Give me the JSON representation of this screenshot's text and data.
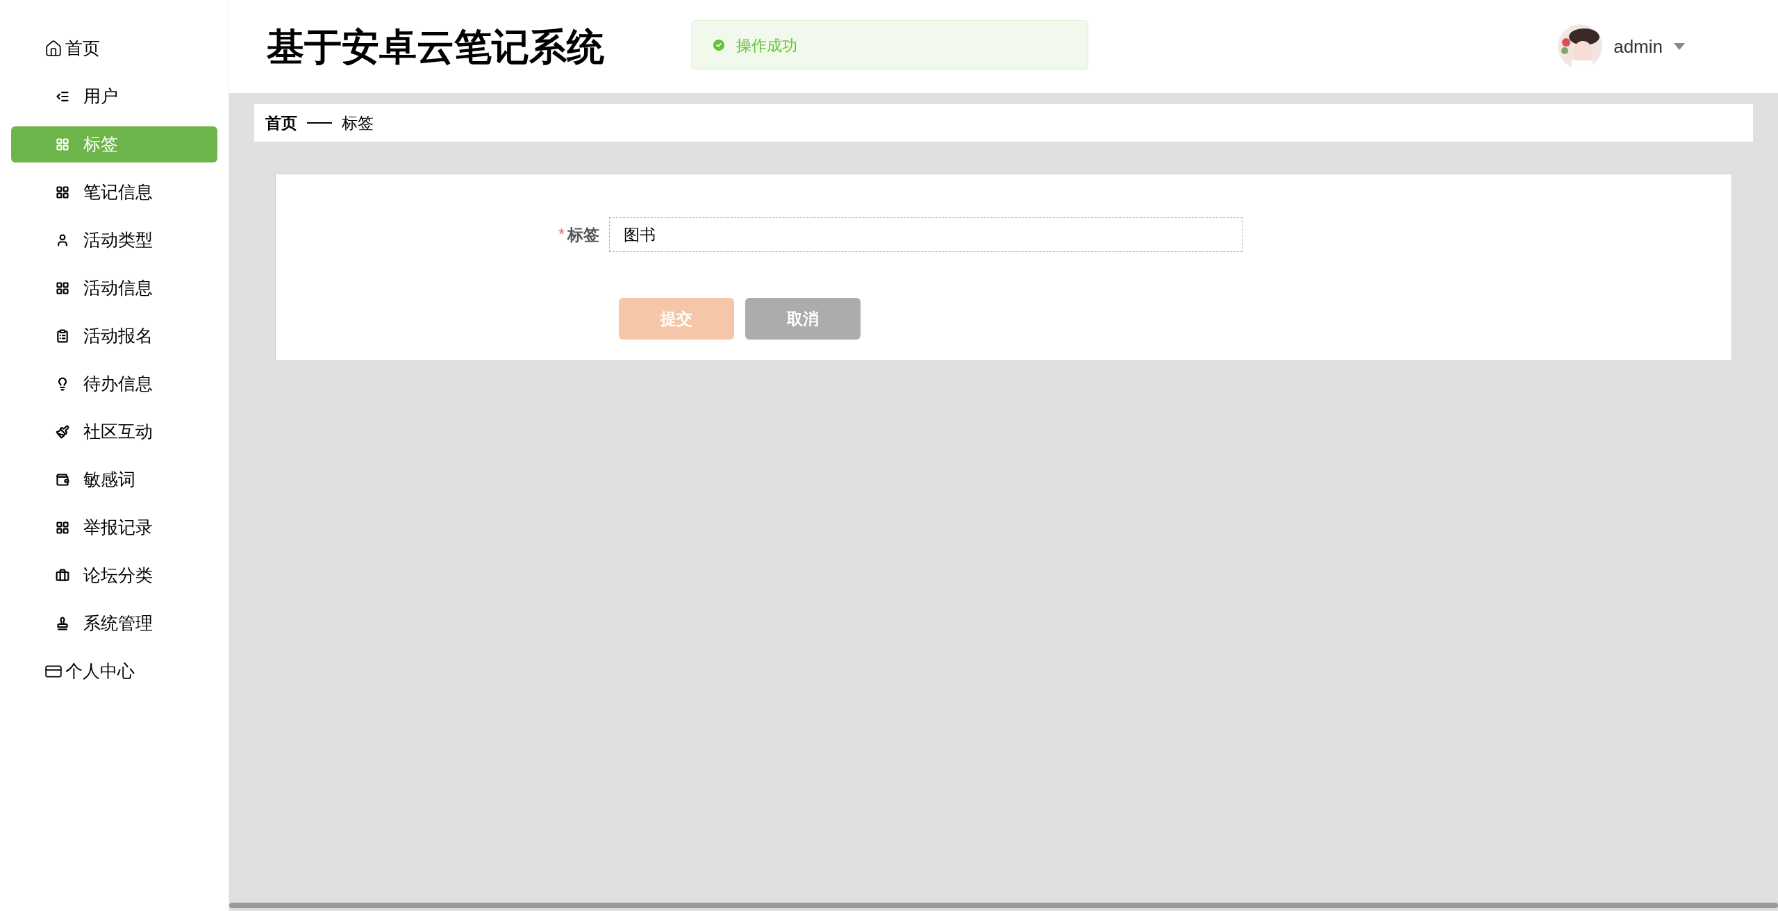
{
  "sidebar": {
    "items": [
      {
        "label": "首页",
        "kind": "top",
        "selected": false
      },
      {
        "label": "用户",
        "kind": "sub",
        "selected": false
      },
      {
        "label": "标签",
        "kind": "sub",
        "selected": true
      },
      {
        "label": "笔记信息",
        "kind": "sub",
        "selected": false
      },
      {
        "label": "活动类型",
        "kind": "sub",
        "selected": false
      },
      {
        "label": "活动信息",
        "kind": "sub",
        "selected": false
      },
      {
        "label": "活动报名",
        "kind": "sub",
        "selected": false
      },
      {
        "label": "待办信息",
        "kind": "sub",
        "selected": false
      },
      {
        "label": "社区互动",
        "kind": "sub",
        "selected": false
      },
      {
        "label": "敏感词",
        "kind": "sub",
        "selected": false
      },
      {
        "label": "举报记录",
        "kind": "sub",
        "selected": false
      },
      {
        "label": "论坛分类",
        "kind": "sub",
        "selected": false
      },
      {
        "label": "系统管理",
        "kind": "sub",
        "selected": false
      },
      {
        "label": "个人中心",
        "kind": "top",
        "selected": false
      }
    ]
  },
  "header": {
    "title": "基于安卓云笔记系统",
    "toast": "操作成功",
    "user": "admin"
  },
  "breadcrumb": [
    "首页",
    "标签"
  ],
  "form": {
    "fields": [
      {
        "label": "标签",
        "marker": "*",
        "value": "图书"
      }
    ],
    "buttons": [
      {
        "label": "提交",
        "kind": "primary"
      },
      {
        "label": "取消",
        "kind": "cancel"
      }
    ]
  }
}
